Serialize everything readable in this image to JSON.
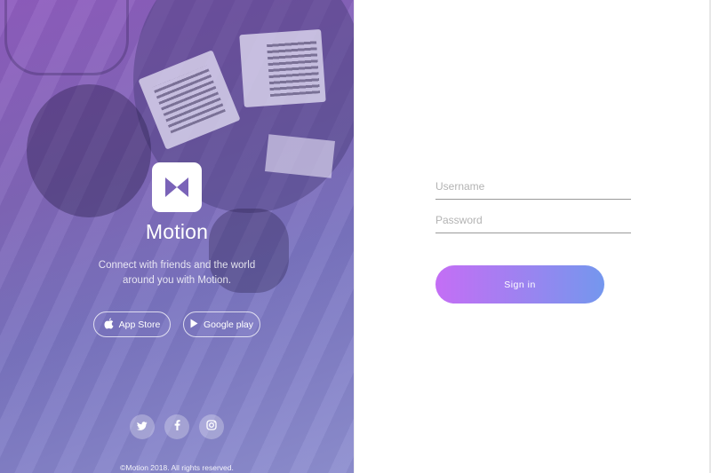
{
  "brand": {
    "name": "Motion",
    "tagline": "Connect with friends and the world around you with Motion.",
    "logo_icon": "bowtie-logo-icon"
  },
  "stores": {
    "app_store_label": "App Store",
    "google_play_label": "Google play"
  },
  "social": [
    {
      "name": "twitter-icon"
    },
    {
      "name": "facebook-icon"
    },
    {
      "name": "instagram-icon"
    }
  ],
  "footer": {
    "copyright": "©Motion 2018. All rights reserved."
  },
  "login": {
    "username_placeholder": "Username",
    "username_value": "",
    "password_placeholder": "Password",
    "password_value": "",
    "signin_label": "Sign in"
  },
  "colors": {
    "gradient_start": "#c46ef5",
    "gradient_end": "#7497ee",
    "panel_purple": "#8066b8"
  }
}
